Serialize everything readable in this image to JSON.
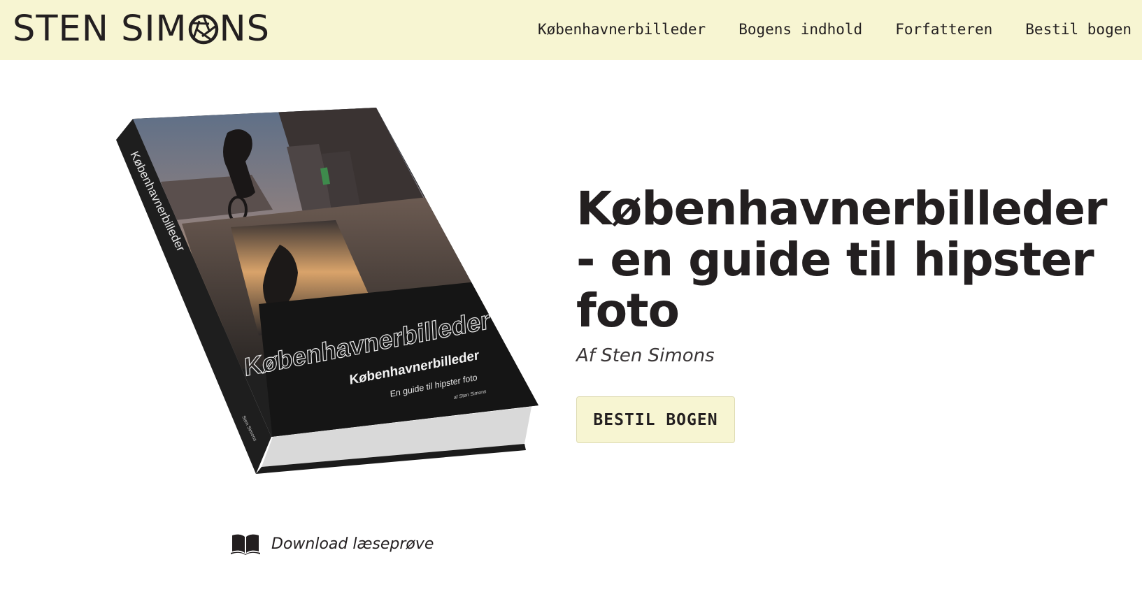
{
  "header": {
    "logo": {
      "left": "STEN SIM",
      "right": "NS"
    },
    "nav": [
      {
        "label": "Københavnerbilleder"
      },
      {
        "label": "Bogens indhold"
      },
      {
        "label": "Forfatteren"
      },
      {
        "label": "Bestil bogen"
      }
    ]
  },
  "hero": {
    "title": "Københavnerbilleder - en guide til hipster foto",
    "byline": "Af Sten Simons",
    "cta_label": "BESTIL BOGEN",
    "download_label": "Download læseprøve"
  },
  "book_cover": {
    "spine_title": "Københavnerbilleder",
    "spine_author": "Sten Simons",
    "watermark": "Københavnerbilleder",
    "title": "Københavnerbilleder",
    "subtitle": "En guide til hipster foto",
    "author": "af Sten Simons"
  },
  "colors": {
    "header_bg": "#f7f5d2",
    "text": "#231f20",
    "cta_bg": "#f7f5d2"
  }
}
